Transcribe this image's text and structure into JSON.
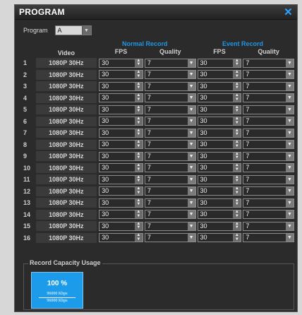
{
  "window": {
    "title": "PROGRAM"
  },
  "program": {
    "label": "Program",
    "value": "A"
  },
  "sections": {
    "normal": "Normal Record",
    "event": "Event Record"
  },
  "headers": {
    "video": "Video",
    "fps": "FPS",
    "quality": "Quality"
  },
  "channels": [
    {
      "num": "1",
      "video": "1080P 30Hz",
      "n_fps": "30",
      "n_q": "7",
      "e_fps": "30",
      "e_q": "7"
    },
    {
      "num": "2",
      "video": "1080P 30Hz",
      "n_fps": "30",
      "n_q": "7",
      "e_fps": "30",
      "e_q": "7"
    },
    {
      "num": "3",
      "video": "1080P 30Hz",
      "n_fps": "30",
      "n_q": "7",
      "e_fps": "30",
      "e_q": "7"
    },
    {
      "num": "4",
      "video": "1080P 30Hz",
      "n_fps": "30",
      "n_q": "7",
      "e_fps": "30",
      "e_q": "7"
    },
    {
      "num": "5",
      "video": "1080P 30Hz",
      "n_fps": "30",
      "n_q": "7",
      "e_fps": "30",
      "e_q": "7"
    },
    {
      "num": "6",
      "video": "1080P 30Hz",
      "n_fps": "30",
      "n_q": "7",
      "e_fps": "30",
      "e_q": "7"
    },
    {
      "num": "7",
      "video": "1080P 30Hz",
      "n_fps": "30",
      "n_q": "7",
      "e_fps": "30",
      "e_q": "7"
    },
    {
      "num": "8",
      "video": "1080P 30Hz",
      "n_fps": "30",
      "n_q": "7",
      "e_fps": "30",
      "e_q": "7"
    },
    {
      "num": "9",
      "video": "1080P 30Hz",
      "n_fps": "30",
      "n_q": "7",
      "e_fps": "30",
      "e_q": "7"
    },
    {
      "num": "10",
      "video": "1080P 30Hz",
      "n_fps": "30",
      "n_q": "7",
      "e_fps": "30",
      "e_q": "7"
    },
    {
      "num": "11",
      "video": "1080P 30Hz",
      "n_fps": "30",
      "n_q": "7",
      "e_fps": "30",
      "e_q": "7"
    },
    {
      "num": "12",
      "video": "1080P 30Hz",
      "n_fps": "30",
      "n_q": "7",
      "e_fps": "30",
      "e_q": "7"
    },
    {
      "num": "13",
      "video": "1080P 30Hz",
      "n_fps": "30",
      "n_q": "7",
      "e_fps": "30",
      "e_q": "7"
    },
    {
      "num": "14",
      "video": "1080P 30Hz",
      "n_fps": "30",
      "n_q": "7",
      "e_fps": "30",
      "e_q": "7"
    },
    {
      "num": "15",
      "video": "1080P 30Hz",
      "n_fps": "30",
      "n_q": "7",
      "e_fps": "30",
      "e_q": "7"
    },
    {
      "num": "16",
      "video": "1080P 30Hz",
      "n_fps": "30",
      "n_q": "7",
      "e_fps": "30",
      "e_q": "7"
    }
  ],
  "usage": {
    "legend": "Record Capacity Usage",
    "percent": "100 %",
    "used": "96000 Kbps",
    "total": "96000 Kbps"
  },
  "colors": {
    "accent": "#1e97e6",
    "usage_block": "#1c9bea"
  },
  "icons": {
    "close": "close-icon",
    "dropdown": "chevron-down-icon",
    "spinner": "spinner-arrows-icon"
  }
}
